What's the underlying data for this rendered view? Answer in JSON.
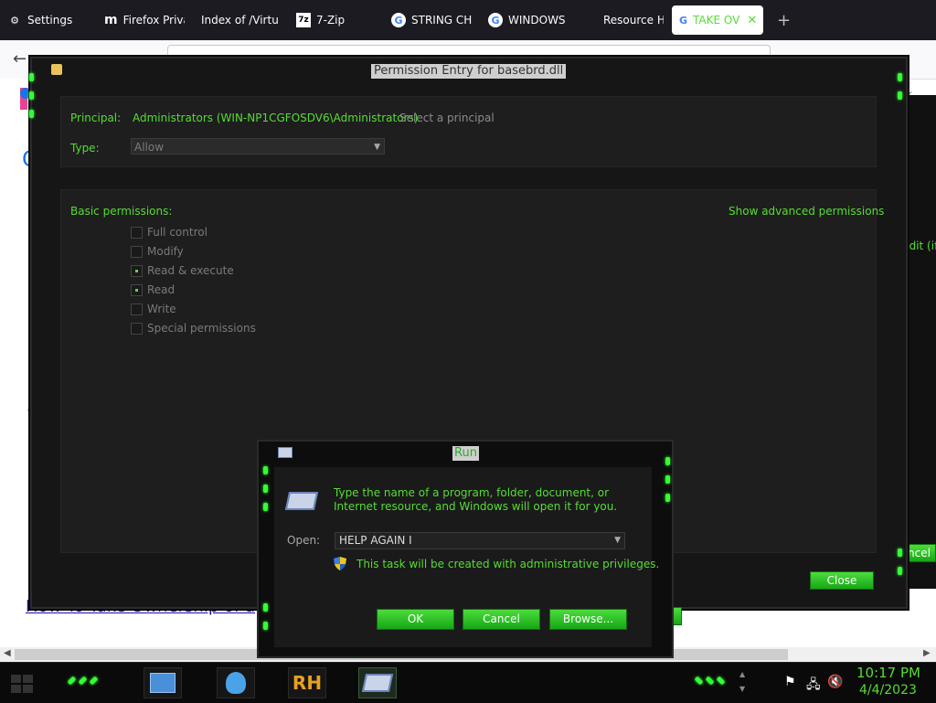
{
  "browser": {
    "tabs": [
      {
        "label": "Settings",
        "icon": "gear-icon"
      },
      {
        "label": "Firefox Priva",
        "icon": "m-icon"
      },
      {
        "label": "Index of /Virtua",
        "icon": "none"
      },
      {
        "label": "7-Zip",
        "icon": "7zip-icon"
      },
      {
        "label": "STRING CH",
        "icon": "google-icon"
      },
      {
        "label": "WINDOWS",
        "icon": "google-icon"
      },
      {
        "label": "Resource H",
        "icon": "none"
      },
      {
        "label": "TAKE OV",
        "icon": "google-icon"
      }
    ],
    "page_link": "How To Take Ownership of a"
  },
  "right_window": {
    "edit_label": "Edit (if",
    "cancel_label": "ncel"
  },
  "permission_dialog": {
    "title": "Permission Entry for basebrd.dll",
    "principal_label": "Principal:",
    "principal_value": "Administrators (WIN-NP1CGFOSDV6\\Administrators)",
    "select_principal": "Select a principal",
    "type_label": "Type:",
    "type_value": "Allow",
    "basic_permissions_label": "Basic permissions:",
    "show_advanced": "Show advanced permissions",
    "permissions": [
      {
        "label": "Full control",
        "checked": false
      },
      {
        "label": "Modify",
        "checked": false
      },
      {
        "label": "Read & execute",
        "checked": true
      },
      {
        "label": "Read",
        "checked": true
      },
      {
        "label": "Write",
        "checked": false
      },
      {
        "label": "Special permissions",
        "checked": false
      }
    ],
    "close_label": "Close"
  },
  "run_dialog": {
    "title": "Run",
    "description": "Type the name of a program, folder, document, or Internet resource, and Windows will open it for you.",
    "open_label": "Open:",
    "open_value": "HELP AGAIN I",
    "admin_note": "This task will be created with administrative privileges.",
    "ok_label": "OK",
    "cancel_label": "Cancel",
    "browse_label": "Browse..."
  },
  "taskbar": {
    "rh_label": "RH",
    "time": "10:17 PM",
    "date": "4/4/2023"
  },
  "colors": {
    "accent_green": "#55dd33",
    "button_green": "#22bb22"
  }
}
